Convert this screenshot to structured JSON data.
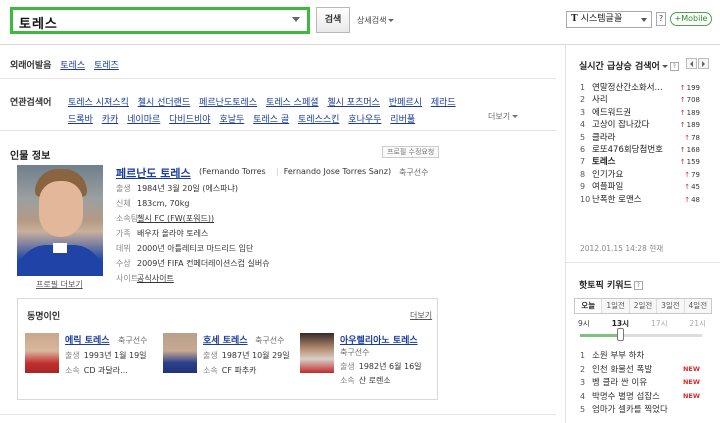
{
  "search": {
    "query": "토레스",
    "button_label": "검색",
    "detail_label": "상세검색"
  },
  "header": {
    "font_select": "시스템글꼴",
    "font_glyph": "T",
    "help": "?",
    "mobile": "+Mobile"
  },
  "foreign": {
    "label": "외래어발음",
    "links": [
      "토레스",
      "토레즈"
    ]
  },
  "related": {
    "label": "연관검색어",
    "more": "더보기",
    "links": [
      "토레스 시져스킥",
      "첼시 선더랜드",
      "페르난도토레스",
      "토레스 스페셜",
      "첼시 포츠머스",
      "반페르시",
      "제라드",
      "드록바",
      "카카",
      "네이마르",
      "다비드비야",
      "호날두",
      "토레스 골",
      "토레스스킨",
      "호나우두",
      "리버풀"
    ]
  },
  "person": {
    "section_title": "인물 정보",
    "edit_request": "프로필 수정요청",
    "name": "페르난도 토레스",
    "name_en": "(Fernando Torres",
    "name_full": "Fernando Jose Torres Sanz)",
    "job": "축구선수",
    "profile_more": "프로필 더보기",
    "info": [
      {
        "key": "출생",
        "value": "1984년 3월 20일 (에스파냐)"
      },
      {
        "key": "신체",
        "value": "183cm, 70kg"
      },
      {
        "key": "소속팀",
        "value": "첼시 FC (FW(포워드))"
      },
      {
        "key": "가족",
        "value": "배우자 올라야 토레스"
      },
      {
        "key": "데뷔",
        "value": "2000년 아틀레티코 마드리드 입단"
      },
      {
        "key": "수상",
        "value": "2009년 FIFA 컨페더레이션스컵 실버슈"
      },
      {
        "key": "사이트",
        "value": "공식사이트"
      }
    ]
  },
  "related_people": {
    "title": "동명이인",
    "more": "더보기",
    "people": [
      {
        "name": "에릭 토레스",
        "job": "축구선수",
        "lines": [
          {
            "k": "출생",
            "v": "1993년 1월 19일"
          },
          {
            "k": "소속",
            "v": "CD 과달라..."
          }
        ]
      },
      {
        "name": "호세 토레스",
        "job": "축구선수",
        "lines": [
          {
            "k": "출생",
            "v": "1987년 10월 29일"
          },
          {
            "k": "소속",
            "v": "CF 파추카"
          }
        ]
      },
      {
        "name": "아우렐리아노 토레스",
        "job": "축구선수",
        "lines": [
          {
            "k": "출생",
            "v": "1982년 6월 16일"
          },
          {
            "k": "소속",
            "v": "산 로렌소"
          }
        ]
      }
    ]
  },
  "realtime": {
    "title": "실시간 급상승 검색어",
    "help": "?",
    "time": "2012.01.15 14:28 현재",
    "items": [
      {
        "rank": "1",
        "text": "연말정산간소화서...",
        "change": "199"
      },
      {
        "rank": "2",
        "text": "사리",
        "change": "708"
      },
      {
        "rank": "3",
        "text": "에드워드권",
        "change": "189"
      },
      {
        "rank": "4",
        "text": "고상이 잡나갔다",
        "change": "189"
      },
      {
        "rank": "5",
        "text": "클라라",
        "change": "78"
      },
      {
        "rank": "6",
        "text": "로또476회당첨번호",
        "change": "168"
      },
      {
        "rank": "7",
        "text": "토레스",
        "change": "159",
        "bold": true
      },
      {
        "rank": "8",
        "text": "인기가요",
        "change": "79"
      },
      {
        "rank": "9",
        "text": "여플파일",
        "change": "45"
      },
      {
        "rank": "10",
        "text": "난폭한 로맨스",
        "change": "48"
      }
    ]
  },
  "hot_keyword": {
    "title": "핫토픽 키워드",
    "help": "?",
    "tabs": [
      "오늘",
      "1일전",
      "2일전",
      "3일전",
      "4일전"
    ],
    "times": [
      "9시",
      "13시",
      "17시",
      "21시"
    ],
    "slider_fraction": 0.33,
    "items": [
      {
        "rank": "1",
        "text": "소원 부부 하차",
        "new": ""
      },
      {
        "rank": "2",
        "text": "인천 화물선 폭발",
        "new": "NEW"
      },
      {
        "rank": "3",
        "text": "벵 클라 싼 이유",
        "new": "NEW"
      },
      {
        "rank": "4",
        "text": "박명수 별명 섭잡스",
        "new": "NEW"
      },
      {
        "rank": "5",
        "text": "엄마가 셀카를 찍었다",
        "new": ""
      }
    ]
  },
  "colors": {
    "link": "#1a3c9c",
    "search_border": "#3db93d",
    "up_arrow": "#d63030",
    "new_badge": "#e02a2a"
  }
}
